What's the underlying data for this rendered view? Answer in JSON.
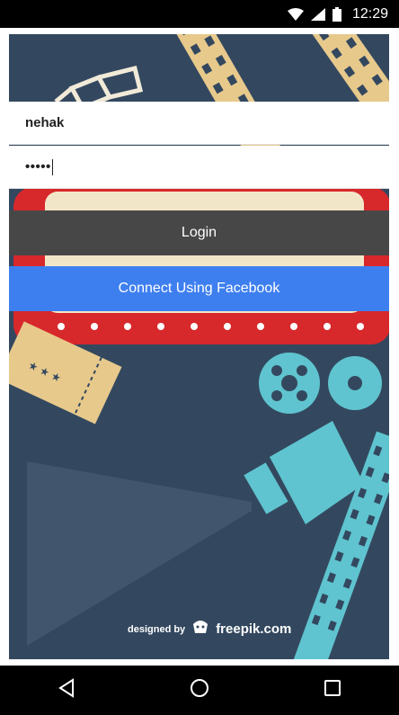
{
  "status_bar": {
    "time": "12:29",
    "icons": [
      "wifi-icon",
      "signal-icon",
      "battery-icon"
    ]
  },
  "login_form": {
    "username_value": "nehak",
    "password_masked": "•••••",
    "login_label": "Login",
    "facebook_label": "Connect Using Facebook"
  },
  "credit": {
    "prefix": "designed by",
    "brand": "freepik.com"
  },
  "nav_bar": {
    "icons": [
      "back-icon",
      "home-icon",
      "recents-icon"
    ]
  },
  "colors": {
    "poster_bg": "#33485f",
    "login_button": "#474747",
    "facebook_button": "#3e7ff0",
    "marquee_red": "#d7282b",
    "film_gold": "#e7c98c",
    "projector_teal": "#5fc4cf"
  }
}
